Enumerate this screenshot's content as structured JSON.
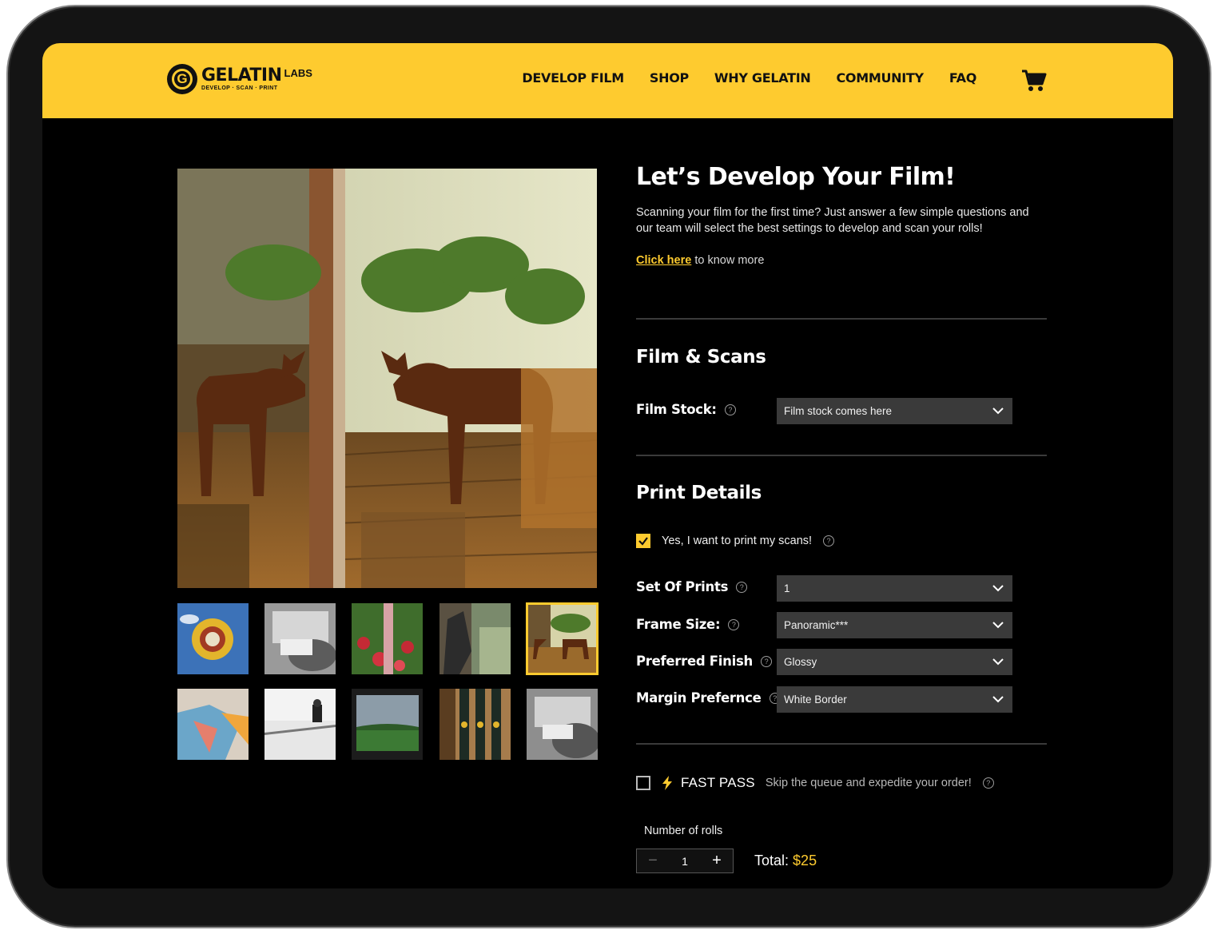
{
  "nav": {
    "brand": "GELATIN",
    "brand_suffix": "LABS",
    "tagline": "DEVELOP · SCAN · PRINT",
    "links": [
      "DEVELOP FILM",
      "SHOP",
      "WHY GELATIN",
      "COMMUNITY",
      "FAQ"
    ],
    "cart_icon": "cart-icon"
  },
  "gallery": {
    "selected_index": 4,
    "thumbnail_count": 10
  },
  "intro": {
    "title": "Let’s Develop Your Film!",
    "description": "Scanning your film for the first time? Just answer a few simple questions and our team will select the best settings to develop and scan your rolls!",
    "link_text": "Click here",
    "link_suffix": " to know more"
  },
  "film_scans": {
    "title": "Film & Scans",
    "film_stock_label": "Film Stock:",
    "film_stock_value": "Film stock comes here"
  },
  "print_details": {
    "title": "Print Details",
    "print_checkbox_label": "Yes, I want to print my scans!",
    "print_checked": true,
    "fields": [
      {
        "label": "Set Of Prints",
        "value": "1"
      },
      {
        "label": "Frame Size:",
        "value": "Panoramic***"
      },
      {
        "label": "Preferred Finish",
        "value": "Glossy"
      },
      {
        "label": "Margin Prefernce",
        "value": "White Border"
      }
    ]
  },
  "fast_pass": {
    "label": "FAST PASS",
    "description": "Skip the queue and expedite your order!",
    "checked": false
  },
  "order": {
    "rolls_label": "Number of rolls",
    "rolls_value": "1",
    "minus": "−",
    "plus": "+",
    "total_label": "Total:",
    "total_value": "$25"
  },
  "colors": {
    "accent": "#fecb2f",
    "background": "#000000",
    "select_bg": "#3a3a3a"
  }
}
